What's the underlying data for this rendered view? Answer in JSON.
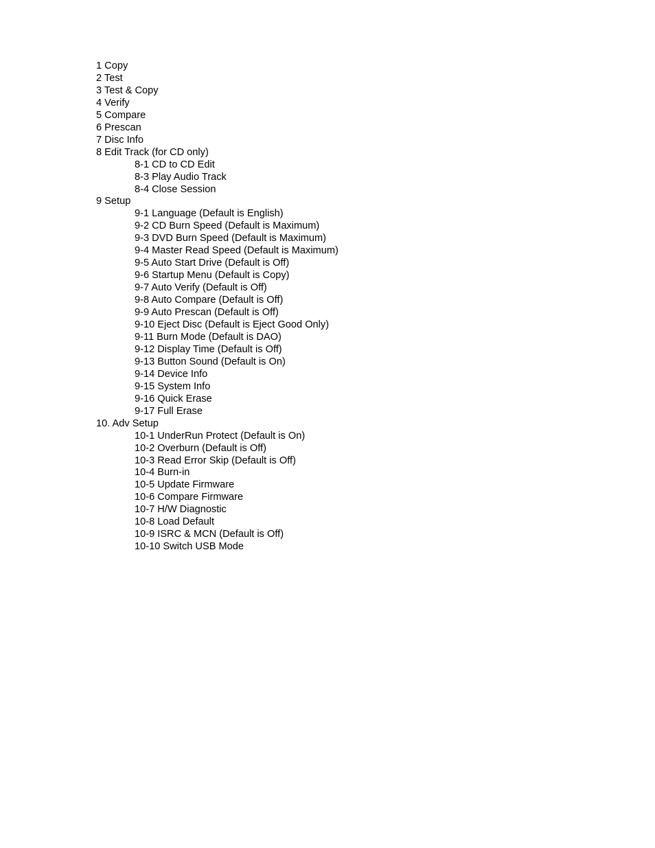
{
  "menu": {
    "items": [
      {
        "label": "1 Copy",
        "children": []
      },
      {
        "label": "2 Test",
        "children": []
      },
      {
        "label": "3 Test & Copy",
        "children": []
      },
      {
        "label": "4 Verify",
        "children": []
      },
      {
        "label": "5 Compare",
        "children": []
      },
      {
        "label": "6 Prescan",
        "children": []
      },
      {
        "label": "7 Disc Info",
        "children": []
      },
      {
        "label": "8 Edit Track (for CD only)",
        "children": [
          "8-1 CD to CD Edit",
          "8-3 Play Audio Track",
          "8-4 Close Session"
        ]
      },
      {
        "label": "9 Setup",
        "children": [
          "9-1 Language (Default is English)",
          "9-2 CD Burn Speed (Default is Maximum)",
          "9-3 DVD Burn Speed (Default is Maximum)",
          "9-4 Master Read Speed (Default is Maximum)",
          "9-5 Auto Start Drive (Default is Off)",
          "9-6 Startup Menu (Default is Copy)",
          "9-7 Auto Verify (Default is Off)",
          "9-8 Auto Compare (Default is Off)",
          "9-9 Auto Prescan (Default is Off)",
          "9-10 Eject Disc (Default is Eject Good Only)",
          "9-11 Burn Mode (Default is DAO)",
          "9-12 Display Time (Default is Off)",
          "9-13 Button Sound (Default is On)",
          "9-14 Device Info",
          "9-15 System Info",
          "9-16 Quick Erase",
          "9-17 Full Erase"
        ]
      },
      {
        "label": "10. Adv Setup",
        "children": [
          "10-1 UnderRun Protect (Default is On)",
          "10-2 Overburn (Default is Off)",
          "10-3 Read Error Skip (Default is Off)",
          "10-4 Burn-in",
          "10-5 Update Firmware",
          "10-6 Compare Firmware",
          "10-7 H/W Diagnostic",
          "10-8 Load Default",
          "10-9 ISRC & MCN (Default is Off)",
          "10-10 Switch USB Mode"
        ]
      }
    ]
  }
}
